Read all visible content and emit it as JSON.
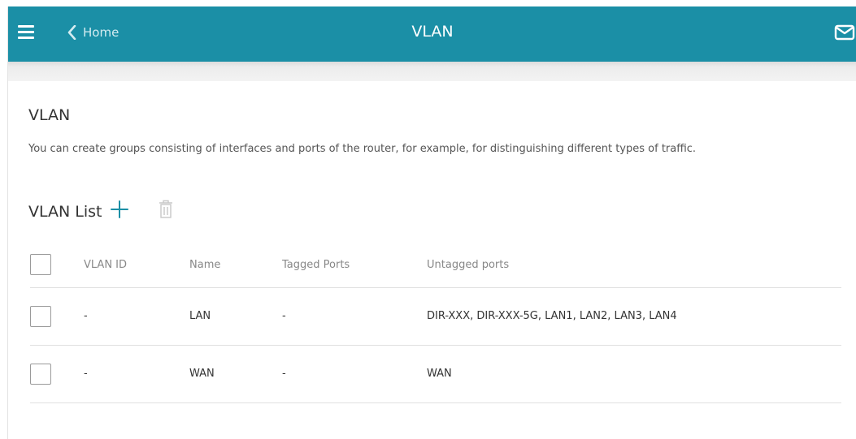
{
  "topbar": {
    "back_label": "Home",
    "title": "VLAN",
    "icons": {
      "menu": "hamburger-menu-icon",
      "back": "chevron-left-icon",
      "mail": "mail-icon"
    },
    "color": "#1b8fa6"
  },
  "page": {
    "heading": "VLAN",
    "description": "You can create groups consisting of interfaces and ports of the router, for example, for distinguishing different types of traffic."
  },
  "vlan_list": {
    "title": "VLAN List",
    "icons": {
      "add": "plus-icon",
      "delete": "trash-icon"
    },
    "columns": {
      "vlan_id": "VLAN ID",
      "name": "Name",
      "tagged": "Tagged Ports",
      "untagged": "Untagged ports"
    },
    "rows": [
      {
        "vlan_id": "-",
        "name": "LAN",
        "tagged": "-",
        "untagged": "DIR-XXX, DIR-XXX-5G, LAN1, LAN2, LAN3, LAN4"
      },
      {
        "vlan_id": "-",
        "name": "WAN",
        "tagged": "-",
        "untagged": "WAN"
      }
    ]
  }
}
